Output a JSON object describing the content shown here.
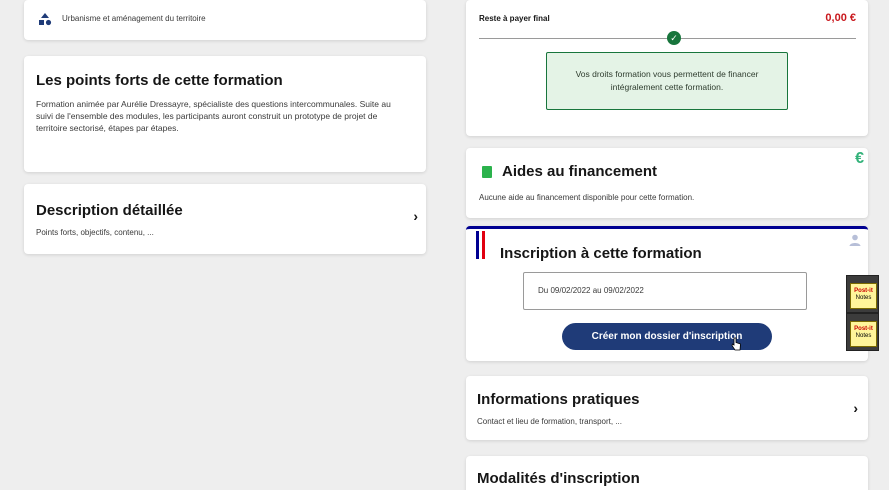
{
  "left": {
    "theme": {
      "label": "Urbanisme et aménagement du territoire",
      "icon": "shapes-icon"
    },
    "points_forts": {
      "title": "Les points forts de cette formation",
      "text": "Formation animée par Aurélie Dressayre, spécialiste des questions intercommunales. Suite au suivi de l'ensemble des modules, les participants auront construit un prototype de projet de territoire sectorisé, étapes par étapes."
    },
    "description": {
      "title": "Description détaillée",
      "subtitle": "Points forts, objectifs, contenu, ...",
      "chevron": "›"
    }
  },
  "right": {
    "payment": {
      "label": "Reste à payer final",
      "value": "0,00 €",
      "check": "✓",
      "message": "Vos droits formation vous permettent de financer intégralement cette formation.",
      "status_color": "#18753c"
    },
    "aides": {
      "title": "Aides au financement",
      "subtitle": "Aucune aide au financement disponible pour cette formation.",
      "euro": "€"
    },
    "inscription": {
      "title": "Inscription à cette formation",
      "date_range": "Du 09/02/2022 au 09/02/2022",
      "cta_label": "Créer mon dossier d'inscription",
      "cta_color": "#1f3b78",
      "accent_blue": "#000091",
      "accent_red": "#e1000f"
    },
    "infos": {
      "title": "Informations pratiques",
      "subtitle": "Contact et lieu de formation, transport, ...",
      "chevron": "›"
    },
    "modalites": {
      "title": "Modalités d'inscription"
    }
  },
  "desktop": {
    "postit": [
      {
        "brand": "Post-it",
        "label": "Notes"
      },
      {
        "brand": "Post-it",
        "label": "Notes"
      }
    ]
  }
}
